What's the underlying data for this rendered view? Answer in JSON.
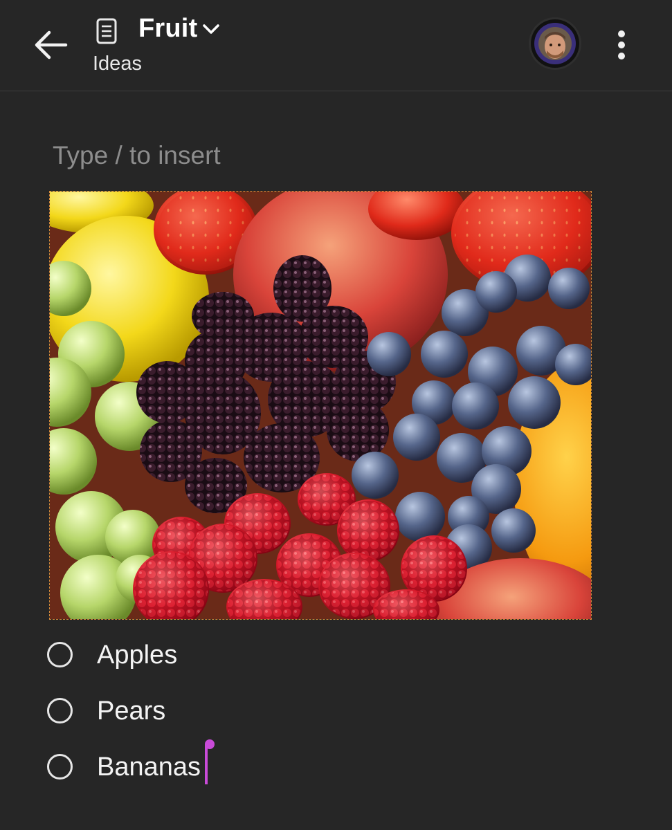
{
  "header": {
    "back_icon": "arrow-left-icon",
    "doc_icon": "document-icon",
    "title": "Fruit",
    "title_dropdown_icon": "chevron-down-icon",
    "subtitle": "Ideas",
    "avatar_icon": "user-avatar",
    "more_icon": "more-vertical-icon"
  },
  "editor": {
    "placeholder": "Type / to insert",
    "image_description": "fruit-photo",
    "checklist": [
      {
        "label": "Apples",
        "checked": false
      },
      {
        "label": "Pears",
        "checked": false
      },
      {
        "label": "Bananas",
        "checked": false
      }
    ]
  },
  "colors": {
    "background": "#262626",
    "accent_caret": "#c94bd8",
    "image_selection_border": "#d4893a"
  }
}
